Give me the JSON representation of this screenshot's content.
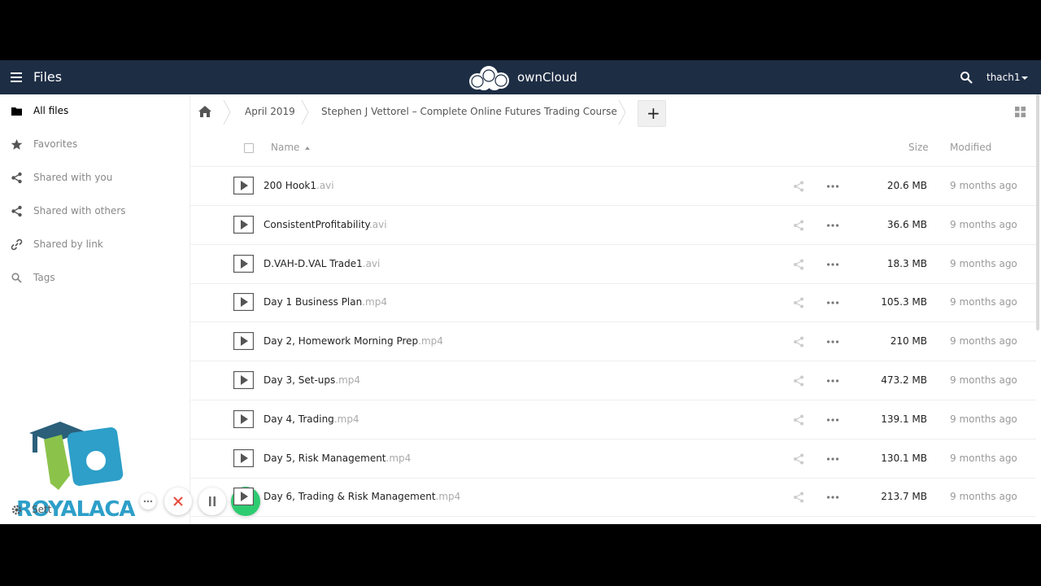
{
  "header": {
    "app_title": "Files",
    "brand": "ownCloud",
    "user": "thach1"
  },
  "sidebar": {
    "items": [
      {
        "label": "All files",
        "icon": "folder-icon",
        "active": true
      },
      {
        "label": "Favorites",
        "icon": "star-icon",
        "active": false
      },
      {
        "label": "Shared with you",
        "icon": "share-icon",
        "active": false
      },
      {
        "label": "Shared with others",
        "icon": "share-icon",
        "active": false
      },
      {
        "label": "Shared by link",
        "icon": "link-icon",
        "active": false
      },
      {
        "label": "Tags",
        "icon": "search-icon",
        "active": false
      }
    ],
    "settings_label": "Sett"
  },
  "watermark": {
    "text": "ROYALACA"
  },
  "breadcrumbs": [
    "April 2019",
    "Stephen J Vettorel – Complete Online Futures Trading Course"
  ],
  "add_button": "+",
  "table": {
    "columns": {
      "name": "Name",
      "size": "Size",
      "modified": "Modified"
    },
    "rows": [
      {
        "name": "200 Hook1",
        "ext": ".avi",
        "size": "20.6 MB",
        "modified": "9 months ago"
      },
      {
        "name": "ConsistentProfitability",
        "ext": ".avi",
        "size": "36.6 MB",
        "modified": "9 months ago"
      },
      {
        "name": "D.VAH-D.VAL Trade1",
        "ext": ".avi",
        "size": "18.3 MB",
        "modified": "9 months ago"
      },
      {
        "name": "Day 1 Business Plan",
        "ext": ".mp4",
        "size": "105.3 MB",
        "modified": "9 months ago"
      },
      {
        "name": "Day 2, Homework Morning Prep",
        "ext": ".mp4",
        "size": "210 MB",
        "modified": "9 months ago"
      },
      {
        "name": "Day 3, Set-ups",
        "ext": ".mp4",
        "size": "473.2 MB",
        "modified": "9 months ago"
      },
      {
        "name": "Day 4, Trading",
        "ext": ".mp4",
        "size": "139.1 MB",
        "modified": "9 months ago"
      },
      {
        "name": "Day 5, Risk Management",
        "ext": ".mp4",
        "size": "130.1 MB",
        "modified": "9 months ago"
      },
      {
        "name": "Day 6, Trading & Risk Management",
        "ext": ".mp4",
        "size": "213.7 MB",
        "modified": "9 months ago"
      }
    ]
  },
  "colors": {
    "header_bg": "#1d2d44",
    "accent_green": "#2ecc71",
    "cancel_red": "#e74c3c"
  }
}
